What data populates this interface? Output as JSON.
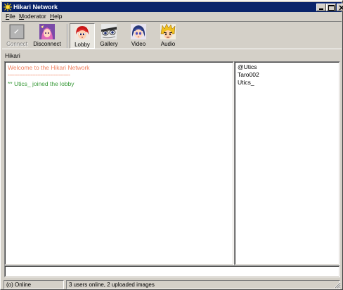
{
  "window": {
    "title": "Hikari Network"
  },
  "menu": [
    {
      "label": "File",
      "accel": "F",
      "rest": "ile"
    },
    {
      "label": "Moderator",
      "accel": "M",
      "rest": "oderator"
    },
    {
      "label": "Help",
      "accel": "H",
      "rest": "elp"
    }
  ],
  "toolbar": {
    "connect": "Connect",
    "disconnect": "Disconnect",
    "lobby": "Lobby",
    "gallery": "Gallery",
    "video": "Video",
    "audio": "Audio"
  },
  "room": {
    "name": "Hikari"
  },
  "chat": {
    "welcome": "Welcome to the Hikari Network",
    "separator": "--------------------------------------",
    "join": "** Utics_ joined the lobby",
    "colors": {
      "welcome": "#f08060",
      "join": "#3a9a3a"
    }
  },
  "users": [
    "@Utics",
    "Taro002",
    "Utics_"
  ],
  "input": {
    "value": ""
  },
  "status": {
    "connection": "(o) Online",
    "summary": "3 users online, 2 uploaded images"
  },
  "icons": {
    "app": "sun-icon",
    "connect": "plug-icon",
    "disconnect": "anime-avatar-icon",
    "lobby": "anime-face-red-icon",
    "gallery": "anime-face-eyes-icon",
    "video": "anime-face-blue-icon",
    "audio": "anime-face-yellow-icon"
  }
}
